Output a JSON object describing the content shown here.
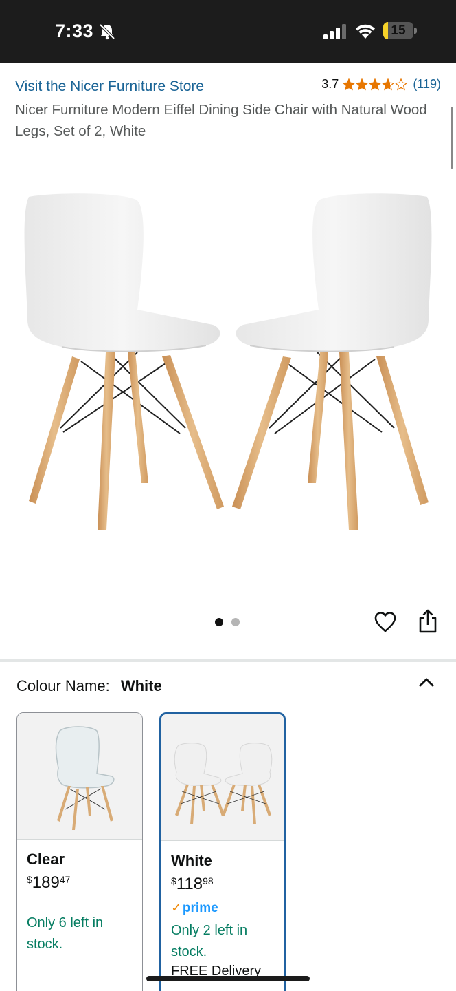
{
  "status_bar": {
    "time": "7:33",
    "battery": "15",
    "battery_level": 0.15
  },
  "header": {
    "store_link": "Visit the Nicer Furniture Store",
    "rating_value": "3.7",
    "rating_stars": 3.7,
    "rating_count": "(119)",
    "product_title": "Nicer Furniture Modern Eiffel Dining Side Chair with Natural Wood Legs, Set of 2, White"
  },
  "gallery": {
    "image_count": 2,
    "active_index": 0
  },
  "variations": {
    "label": "Colour Name:",
    "selected_value": "White",
    "options": [
      {
        "name": "Clear",
        "price_currency": "$",
        "price_whole": "189",
        "price_cents": "47",
        "prime": false,
        "stock": "Only 6 left in stock."
      },
      {
        "name": "White",
        "price_currency": "$",
        "price_whole": "118",
        "price_cents": "98",
        "prime": true,
        "prime_label": "prime",
        "stock": "Only 2 left in stock.",
        "delivery": "FREE Delivery"
      }
    ]
  },
  "colors": {
    "link": "#1a6496",
    "stock_green": "#067d62",
    "selected_border": "#2162a1",
    "prime_blue": "#1a98ff",
    "star_orange": "#e77600"
  }
}
